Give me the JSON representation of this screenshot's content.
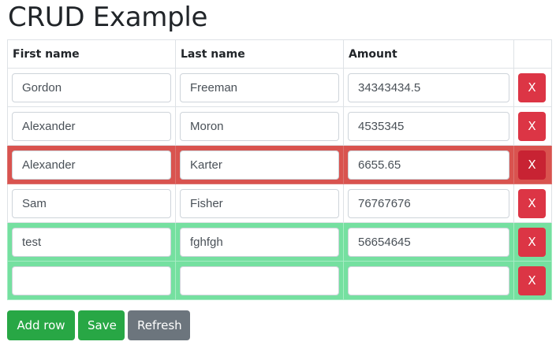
{
  "page": {
    "title": "CRUD Example"
  },
  "table": {
    "headers": {
      "first_name": "First name",
      "last_name": "Last name",
      "amount": "Amount",
      "actions": ""
    },
    "rows": [
      {
        "first_name": "Gordon",
        "last_name": "Freeman",
        "amount": "34343434.5",
        "state": "normal",
        "delete_label": "X"
      },
      {
        "first_name": "Alexander",
        "last_name": "Moron",
        "amount": "4535345",
        "state": "normal",
        "delete_label": "X"
      },
      {
        "first_name": "Alexander",
        "last_name": "Karter",
        "amount": "6655.65",
        "state": "deleted",
        "delete_label": "X"
      },
      {
        "first_name": "Sam",
        "last_name": "Fisher",
        "amount": "76767676",
        "state": "normal",
        "delete_label": "X"
      },
      {
        "first_name": "test",
        "last_name": "fghfgh",
        "amount": "56654645",
        "state": "new",
        "delete_label": "X"
      },
      {
        "first_name": "",
        "last_name": "",
        "amount": "",
        "state": "new",
        "delete_label": "X"
      }
    ]
  },
  "actions": {
    "add_row_label": "Add row",
    "save_label": "Save",
    "refresh_label": "Refresh"
  },
  "colors": {
    "deleted_row": "#d9534f",
    "new_row": "#75e0a0",
    "danger": "#dc3545",
    "success": "#28a745",
    "secondary": "#6c757d"
  }
}
